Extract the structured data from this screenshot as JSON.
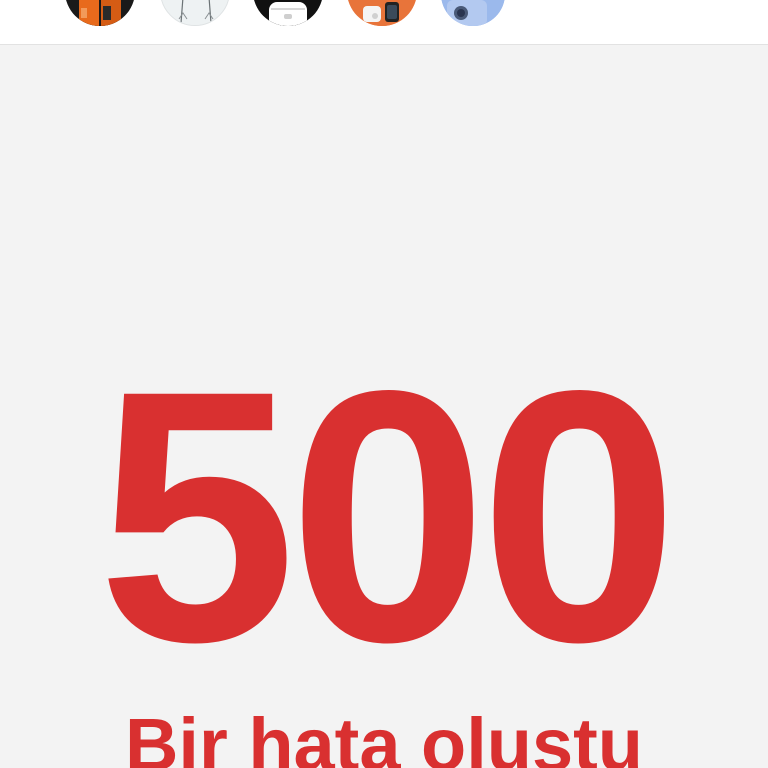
{
  "header": {
    "story_thumbnails": [
      {
        "icon": "orange-phone-thumbnail-icon",
        "accent": "#e86a1c"
      },
      {
        "icon": "white-device-thumbnail-icon",
        "accent": "#e8eef0"
      },
      {
        "icon": "earbuds-case-thumbnail-icon",
        "accent": "#ffffff"
      },
      {
        "icon": "watch-earbuds-thumbnail-icon",
        "accent": "#e8743a"
      },
      {
        "icon": "blue-phone-thumbnail-icon",
        "accent": "#8fb0e8"
      }
    ]
  },
  "error": {
    "code": "500",
    "message": "Bir hata oluştu"
  },
  "colors": {
    "accent": "#d93030",
    "background": "#f3f3f3"
  }
}
